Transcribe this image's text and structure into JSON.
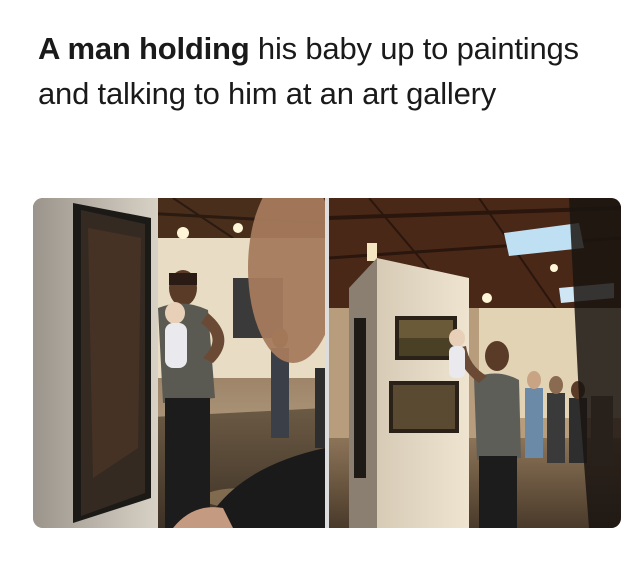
{
  "caption": {
    "bold": "A man holding",
    "rest": " his baby up to paintings and talking to him at an art gallery"
  },
  "photos": [
    {
      "description_icon": "gallery-photo-left"
    },
    {
      "description_icon": "gallery-photo-right"
    }
  ]
}
